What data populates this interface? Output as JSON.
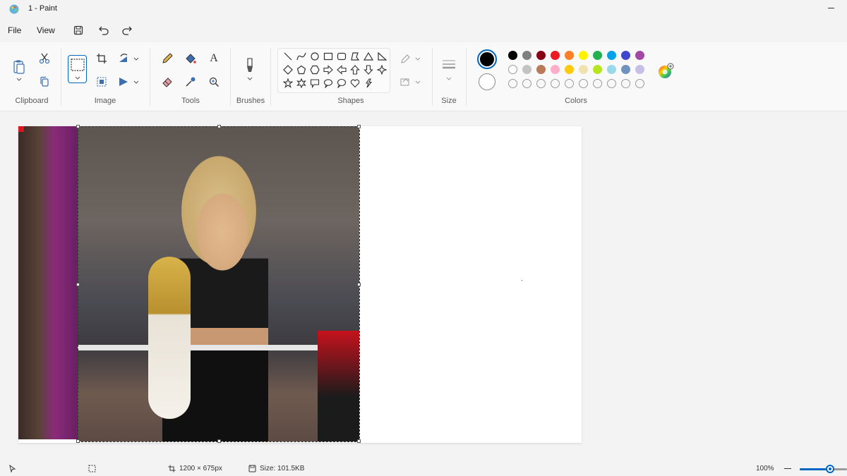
{
  "window": {
    "title": "1 - Paint"
  },
  "menu": {
    "file": "File",
    "view": "View"
  },
  "ribbon": {
    "groups": {
      "clipboard": "Clipboard",
      "image": "Image",
      "tools": "Tools",
      "brushes": "Brushes",
      "shapes": "Shapes",
      "size": "Size",
      "colors": "Colors"
    },
    "text_tool_glyph": "A"
  },
  "colors": {
    "accent": "#0067c0",
    "primary": "#000000",
    "secondary": "#ffffff",
    "palette_row1": [
      "#000000",
      "#7f7f7f",
      "#880015",
      "#ed1c24",
      "#ff7f27",
      "#fff200",
      "#22b14c",
      "#00a2e8",
      "#3f48cc",
      "#a349a4"
    ],
    "palette_row2": [
      "#ffffff",
      "#c3c3c3",
      "#b97a57",
      "#ffaec9",
      "#ffc90e",
      "#efe4b0",
      "#b5e61d",
      "#99d9ea",
      "#7092be",
      "#c8bfe7"
    ],
    "palette_row3_empty": 10
  },
  "status": {
    "image_size": "1200 × 675px",
    "file_size": "Size: 101.5KB",
    "zoom": "100%",
    "zoom_level": 0.55
  }
}
